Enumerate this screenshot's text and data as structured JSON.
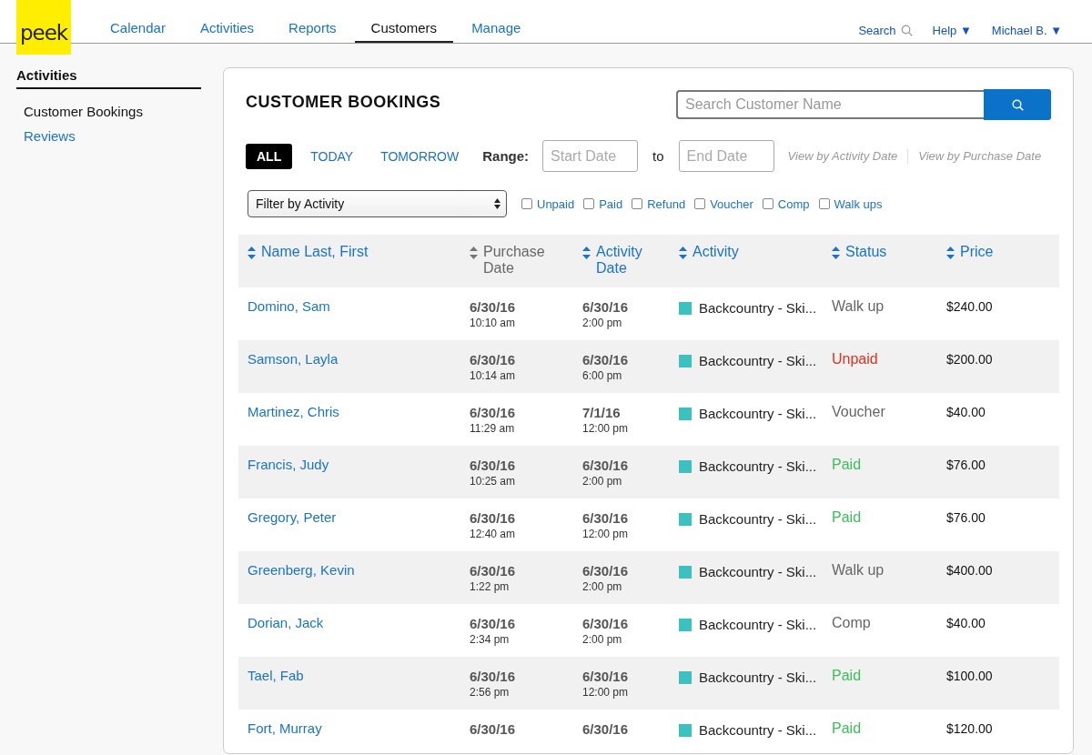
{
  "logo": "peek",
  "nav": [
    {
      "label": "Calendar",
      "selected": false
    },
    {
      "label": "Activities",
      "selected": false
    },
    {
      "label": "Reports",
      "selected": false
    },
    {
      "label": "Customers",
      "selected": true
    },
    {
      "label": "Manage",
      "selected": false
    }
  ],
  "top_right": {
    "search": "Search",
    "help": "Help ▼",
    "user": "Michael B. ▼"
  },
  "sidebar": {
    "heading": "Activities",
    "items": [
      {
        "label": "Customer Bookings",
        "selected": true
      },
      {
        "label": "Reviews",
        "selected": false
      }
    ]
  },
  "title": "CUSTOMER BOOKINGS",
  "search": {
    "placeholder": "Search Customer Name"
  },
  "date_tabs": [
    {
      "label": "ALL",
      "selected": true
    },
    {
      "label": "TODAY",
      "selected": false
    },
    {
      "label": "TOMORROW",
      "selected": false
    }
  ],
  "range": {
    "label": "Range:",
    "start_placeholder": "Start Date",
    "to": "to",
    "end_placeholder": "End Date",
    "view_activity": "View by Activity Date",
    "view_purchase": "View by Purchase Date"
  },
  "filter": {
    "placeholder": "Filter by Activity"
  },
  "status_filters": [
    {
      "label": "Unpaid",
      "checked": false
    },
    {
      "label": "Paid",
      "checked": false
    },
    {
      "label": "Refund",
      "checked": false
    },
    {
      "label": "Voucher",
      "checked": false
    },
    {
      "label": "Comp",
      "checked": false
    },
    {
      "label": "Walk ups",
      "checked": false
    }
  ],
  "table": {
    "columns": [
      {
        "label": "Name Last, First",
        "selected": false
      },
      {
        "label": "Purchase Date",
        "selected": true
      },
      {
        "label": "Activity Date",
        "selected": false
      },
      {
        "label": "Activity",
        "selected": false
      },
      {
        "label": "Status",
        "selected": false
      },
      {
        "label": "Price",
        "selected": false
      }
    ],
    "rows": [
      {
        "name": "Domino, Sam",
        "purchase_date": "6/30/16",
        "purchase_time": "10:10 am",
        "activity_date": "6/30/16",
        "activity_time": "2:00 pm",
        "activity": "Backcountry - Ski...",
        "color": "#3cc1bf",
        "status": {
          "text": "Walk up",
          "color": "#666666"
        },
        "price": "$240.00"
      },
      {
        "name": "Samson, Layla",
        "purchase_date": "6/30/16",
        "purchase_time": "10:14 am",
        "activity_date": "6/30/16",
        "activity_time": "6:00 pm",
        "activity": "Backcountry - Ski...",
        "color": "#3cc1bf",
        "status": {
          "text": "Unpaid",
          "color": "#e0321e"
        },
        "price": "$200.00"
      },
      {
        "name": "Martinez, Chris",
        "purchase_date": "6/30/16",
        "purchase_time": "11:29 am",
        "activity_date": "7/1/16",
        "activity_time": "12:00 pm",
        "activity": "Backcountry - Ski...",
        "color": "#3cc1bf",
        "status": {
          "text": "Voucher",
          "color": "#666666"
        },
        "price": "$40.00"
      },
      {
        "name": "Francis, Judy",
        "purchase_date": "6/30/16",
        "purchase_time": "10:25 am",
        "activity_date": "6/30/16",
        "activity_time": "2:00 pm",
        "activity": "Backcountry - Ski...",
        "color": "#3cc1bf",
        "status": {
          "text": "Paid",
          "color": "#3cbf5a"
        },
        "price": "$76.00"
      },
      {
        "name": "Gregory, Peter",
        "purchase_date": "6/30/16",
        "purchase_time": "12:40 am",
        "activity_date": "6/30/16",
        "activity_time": "12:00 pm",
        "activity": "Backcountry - Ski...",
        "color": "#3cc1bf",
        "status": {
          "text": "Paid",
          "color": "#3cbf5a"
        },
        "price": "$76.00"
      },
      {
        "name": "Greenberg, Kevin",
        "purchase_date": "6/30/16",
        "purchase_time": "1:22 pm",
        "activity_date": "6/30/16",
        "activity_time": "2:00 pm",
        "activity": "Backcountry - Ski...",
        "color": "#3cc1bf",
        "status": {
          "text": "Walk up",
          "color": "#666666"
        },
        "price": "$400.00"
      },
      {
        "name": "Dorian, Jack",
        "purchase_date": "6/30/16",
        "purchase_time": "2:34 pm",
        "activity_date": "6/30/16",
        "activity_time": "2:00 pm",
        "activity": "Backcountry - Ski...",
        "color": "#3cc1bf",
        "status": {
          "text": "Comp",
          "color": "#666666"
        },
        "price": "$40.00"
      },
      {
        "name": "Tael, Fab",
        "purchase_date": "6/30/16",
        "purchase_time": "2:56 pm",
        "activity_date": "6/30/16",
        "activity_time": "12:00 pm",
        "activity": "Backcountry - Ski...",
        "color": "#3cc1bf",
        "status": {
          "text": "Paid",
          "color": "#3cbf5a"
        },
        "price": "$100.00"
      },
      {
        "name": "Fort, Murray",
        "purchase_date": "6/30/16",
        "activity_date": "6/30/16",
        "activity": "Backcountry - Ski...",
        "color": "#3cc1bf",
        "status": {
          "text": "Paid",
          "color": "#3cbf5a"
        },
        "price": "$120.00"
      }
    ]
  }
}
